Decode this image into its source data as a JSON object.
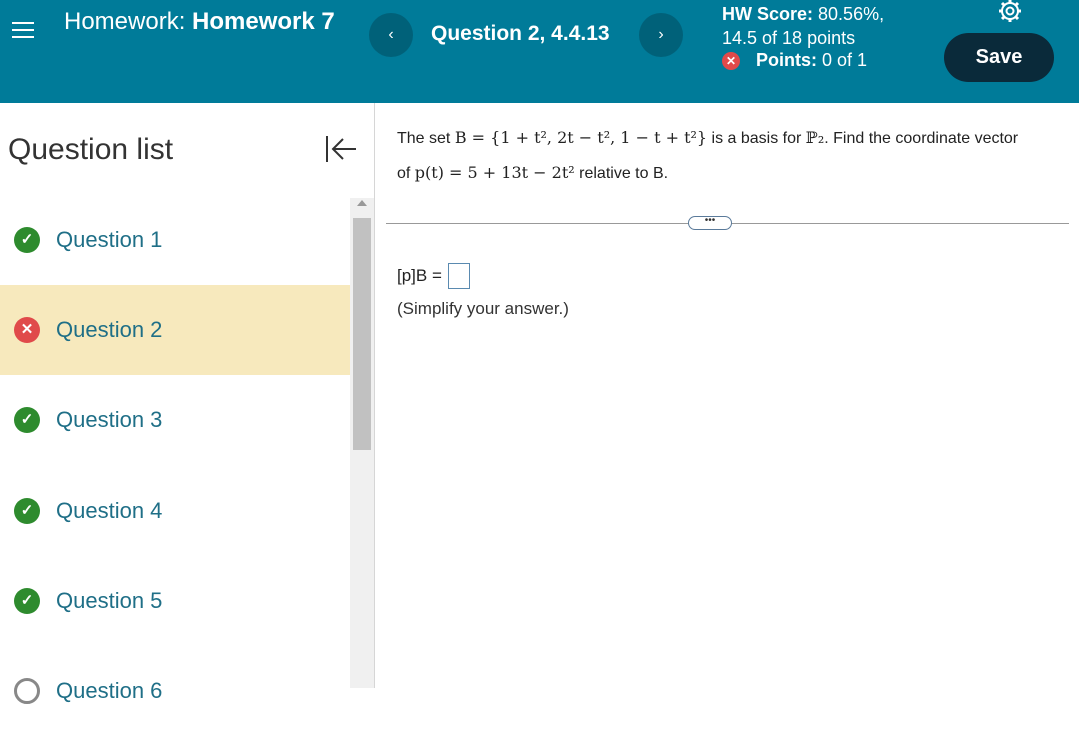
{
  "header": {
    "hw_prefix": "Homework:",
    "hw_name": "Homework 7",
    "question_title": "Question 2, 4.4.13",
    "hw_score_label": "HW Score:",
    "hw_score_value": "80.56%,",
    "hw_points": "14.5 of 18 points",
    "points_label": "Points:",
    "points_value": "0 of 1",
    "save_label": "Save",
    "prev_glyph": "‹",
    "next_glyph": "›"
  },
  "sidebar": {
    "title": "Question list",
    "items": [
      {
        "label": "Question 1",
        "status": "correct"
      },
      {
        "label": "Question 2",
        "status": "incorrect"
      },
      {
        "label": "Question 3",
        "status": "correct"
      },
      {
        "label": "Question 4",
        "status": "correct"
      },
      {
        "label": "Question 5",
        "status": "correct"
      },
      {
        "label": "Question 6",
        "status": "unanswered"
      }
    ]
  },
  "question": {
    "line1_a": "The set ",
    "basis_math": "B = {1 + t², 2t − t², 1 − t + t²}",
    "line1_b": " is a basis for ",
    "space_math": "ℙ₂",
    "line1_c": ". Find the coordinate vector",
    "line2_a": "of ",
    "poly_math": "p(t) = 5 + 13t − 2t²",
    "line2_b": " relative to ",
    "line2_c": "B.",
    "answer_label": "[p]B =",
    "hint": "(Simplify your answer.)",
    "dots": "•••"
  },
  "colors": {
    "header_bg": "#007b99",
    "save_bg": "#0a2a3a",
    "active_row": "#f7e9bd",
    "correct": "#2e8b2e",
    "incorrect": "#e04a4a"
  }
}
